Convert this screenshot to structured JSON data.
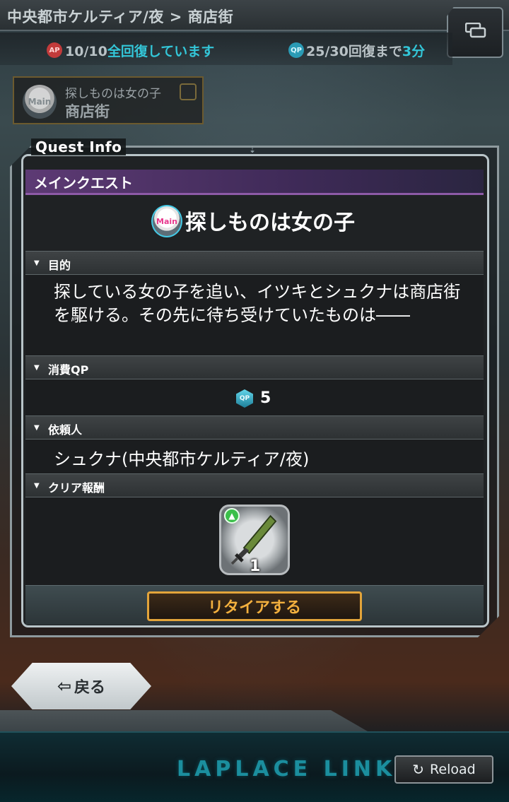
{
  "header": {
    "breadcrumb": "中央都市ケルティア/夜 > 商店街",
    "ap_icon": "AP",
    "ap_value": "10/10",
    "ap_status": "全回復しています",
    "qp_icon": "QP",
    "qp_value": "25/30",
    "qp_status_prefix": "回復まで",
    "qp_status_time": "3分"
  },
  "location": {
    "badge": "Main",
    "subtitle": "探しものは女の子",
    "title": "商店街"
  },
  "dialog": {
    "title": "Quest Info",
    "category": "メインクエスト",
    "quest_badge": "Main",
    "quest_name": "探しものは女の子",
    "sections": {
      "objective_label": "目的",
      "objective_text": "探している女の子を追い、イツキとシュクナは商店街を駆ける。その先に待ち受けていたものは――",
      "cost_label": "消費QP",
      "cost_icon": "QP",
      "cost_value": "5",
      "requester_label": "依頼人",
      "requester_text": "シュクナ(中央都市ケルティア/夜)",
      "reward_label": "クリア報酬",
      "reward_count": "1",
      "reward_icon": "sword-icon"
    },
    "retire_label": "リタイアする"
  },
  "nav": {
    "back_label": "戻る"
  },
  "footer": {
    "logo": "LAPLACE LINK",
    "reload_label": "Reload"
  },
  "colors": {
    "accent_cyan": "#33c6d8",
    "retire_orange": "#e3a43a",
    "main_quest_purple": "#5d3a74"
  }
}
